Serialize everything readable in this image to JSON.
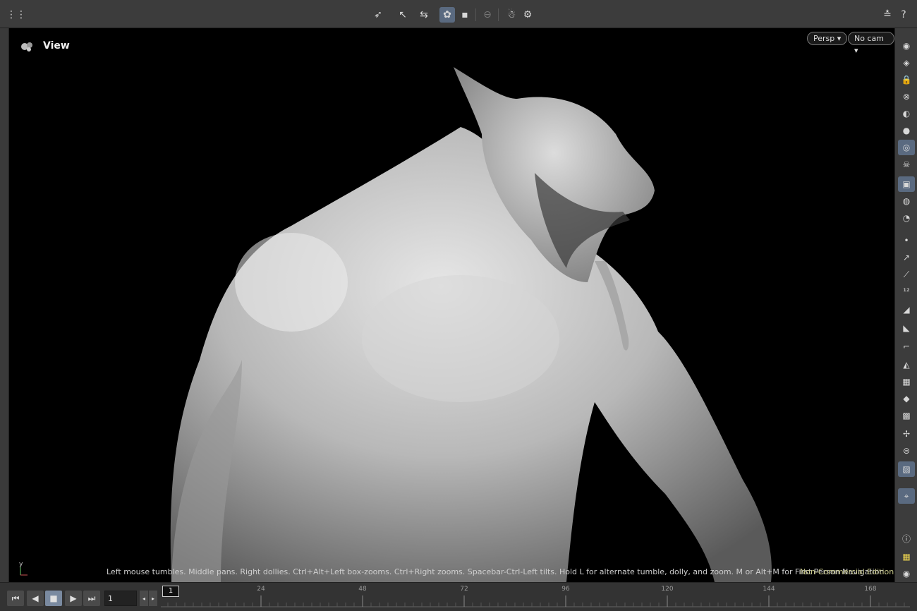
{
  "viewport": {
    "title": "View",
    "projection_menu": "Persp",
    "camera_menu": "No cam",
    "status_text": "Left mouse tumbles. Middle pans. Right dollies. Ctrl+Alt+Left box-zooms. Ctrl+Right zooms. Spacebar-Ctrl-Left tilts. Hold L for alternate tumble, dolly, and zoom. M or Alt+M for First Person Navigation.",
    "edition_text": "Non-Commercial Edition",
    "axis_label": "y"
  },
  "timeline": {
    "current_frame": "1",
    "frame_field": "1",
    "ticks": [
      "24",
      "48",
      "72",
      "96",
      "120",
      "144",
      "168"
    ]
  },
  "colors": {
    "accent_active": "#5a6a80",
    "edition": "#c7c78a"
  }
}
